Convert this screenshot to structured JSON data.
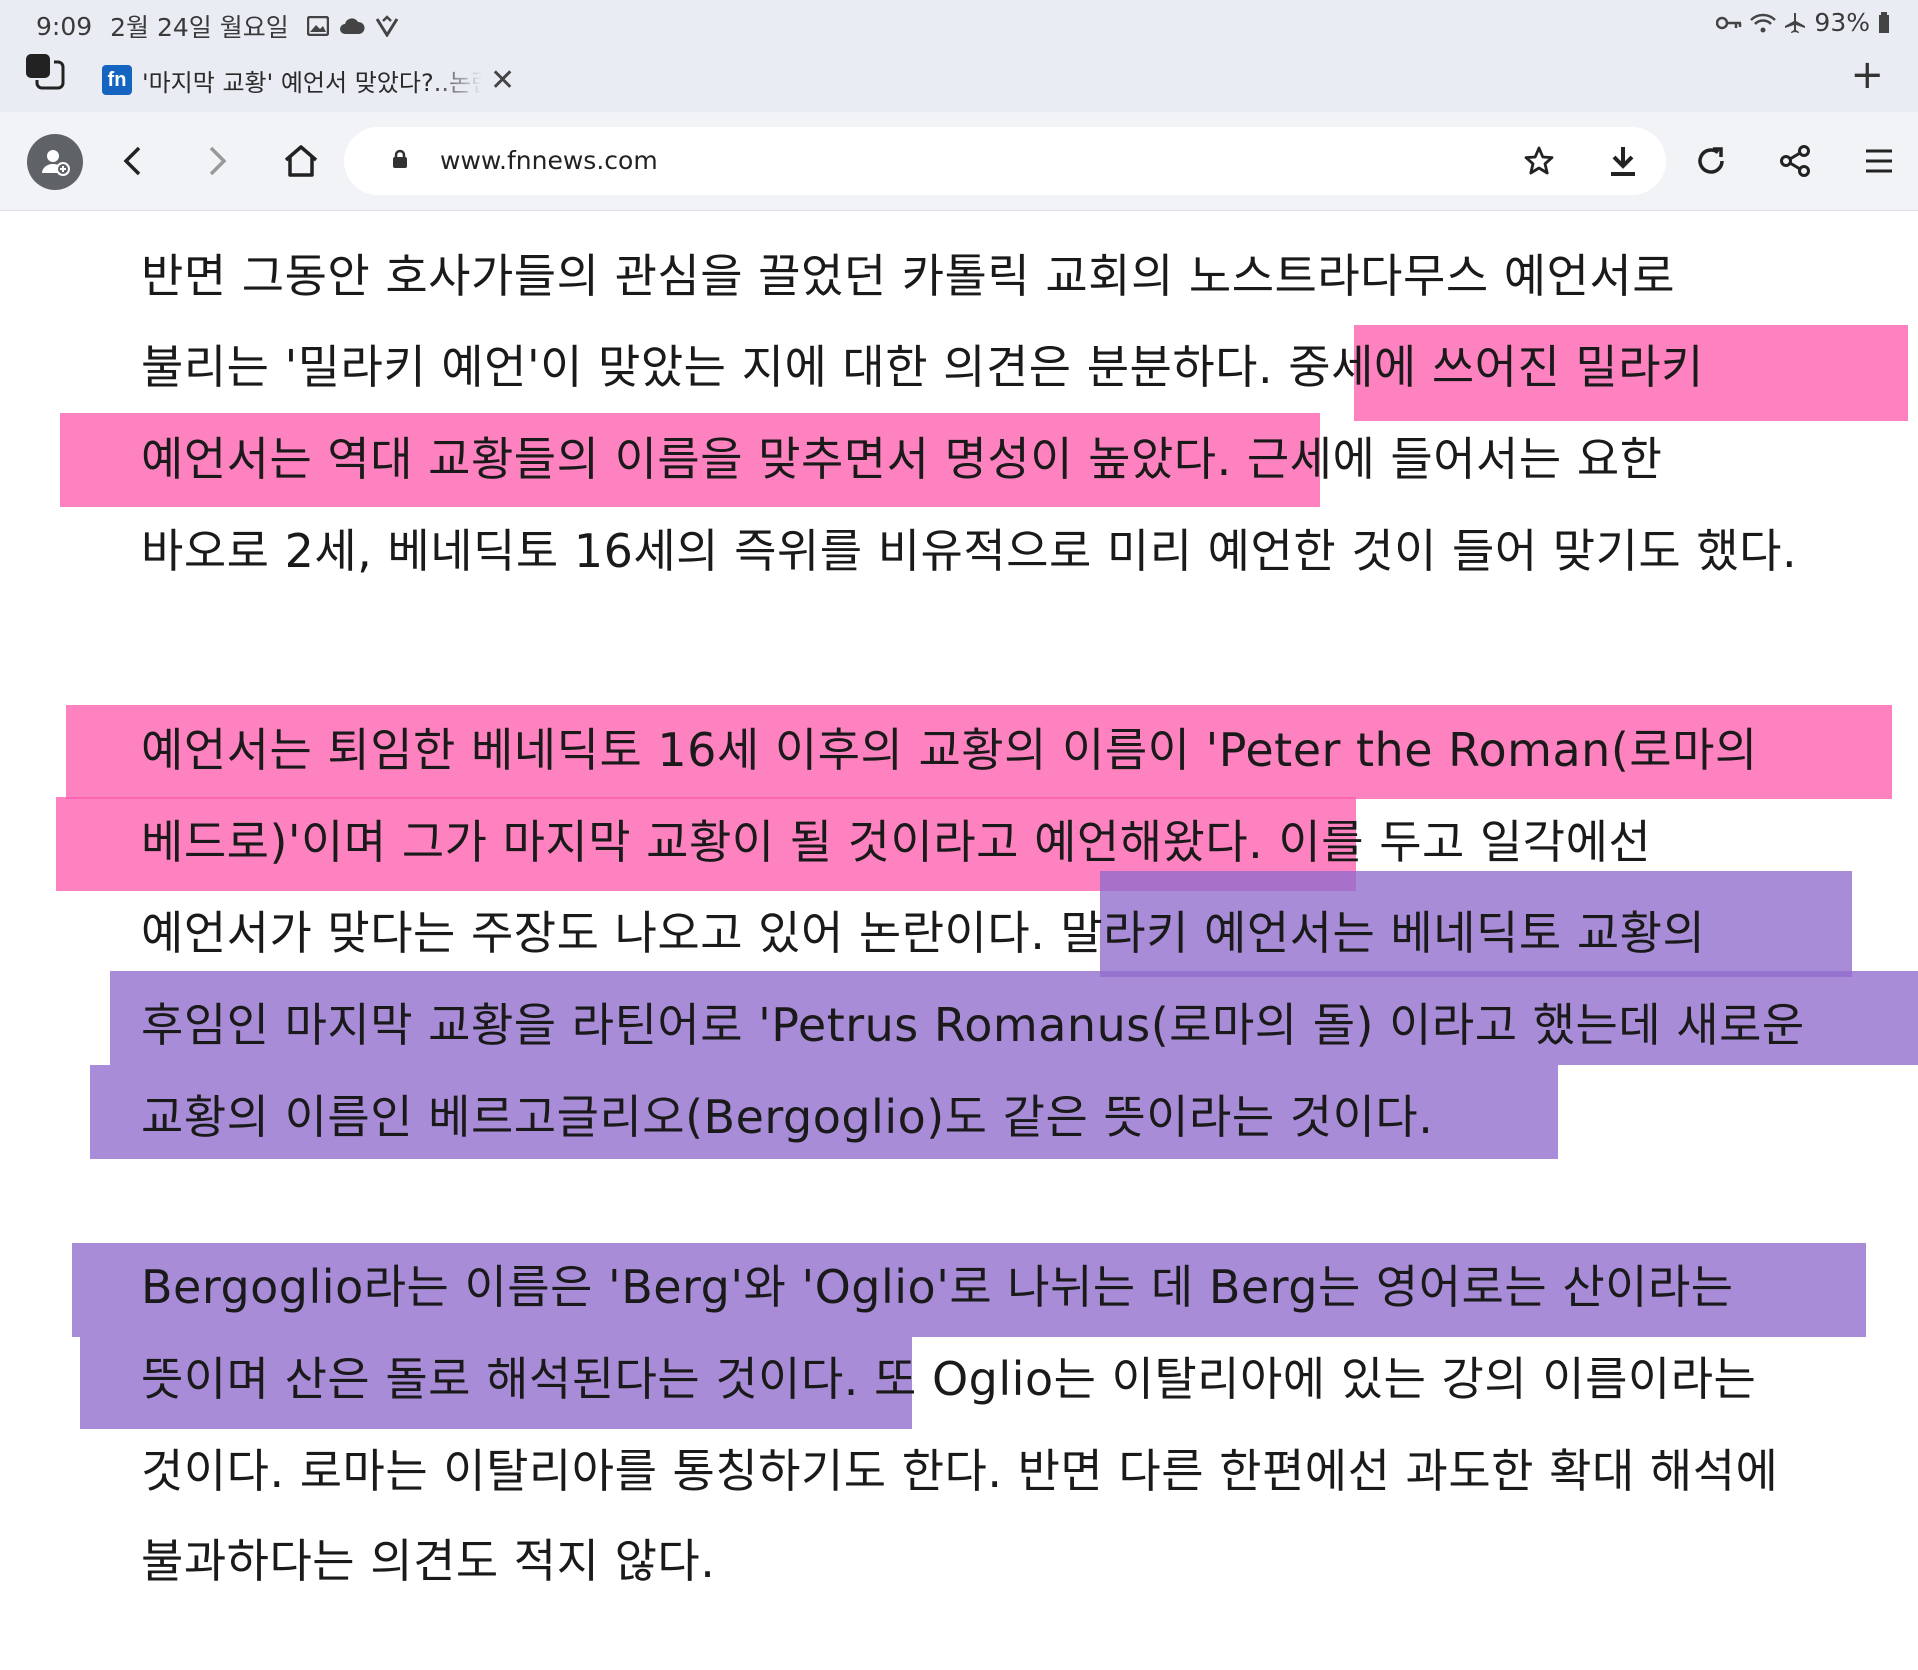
{
  "status_bar": {
    "time": "9:09",
    "date": "2월 24일 월요일",
    "battery": "93%"
  },
  "tab": {
    "favicon": "fn",
    "title": "'마지막 교황' 예언서 맞았다?..논란"
  },
  "toolbar": {
    "url": "www.fnnews.com"
  },
  "article": {
    "lines": [
      "반면 그동안 호사가들의 관심을 끌었던 카톨릭 교회의 노스트라다무스 예언서로",
      "불리는 '밀라키 예언'이 맞았는 지에 대한 의견은 분분하다. 중세에 쓰어진 밀라키",
      "예언서는 역대 교황들의 이름을 맞추면서 명성이 높았다. 근세에 들어서는 요한",
      "바오로 2세, 베네딕토 16세의 즉위를 비유적으로 미리 예언한 것이 들어 맞기도 했다.",
      "예언서는 퇴임한 베네딕토 16세 이후의 교황의 이름이 'Peter the Roman(로마의",
      "베드로)'이며 그가 마지막 교황이 될 것이라고 예언해왔다. 이를 두고 일각에선",
      "예언서가 맞다는 주장도 나오고 있어 논란이다. 말라키 예언서는 베네딕토 교황의",
      "후임인 마지막 교황을 라틴어로 'Petrus Romanus(로마의 돌) 이라고 했는데 새로운",
      "교황의 이름인 베르고글리오(Bergoglio)도 같은 뜻이라는 것이다.",
      "Bergoglio라는 이름은 'Berg'와 'Oglio'로 나뉘는 데 Berg는 영어로는 산이라는",
      "뜻이며 산은 돌로 해석된다는 것이다. 또 Oglio는 이탈리아에 있는 강의 이름이라는",
      "것이다. 로마는 이탈리아를 통칭하기도 한다. 반면 다른 한편에선 과도한 확대 해석에",
      "불과하다는 의견도 적지 않다."
    ]
  },
  "colors": {
    "highlight_pink": "#ff5fae",
    "highlight_purple": "#8f6ccc",
    "chrome_bg": "#e9edf3",
    "toolbar_bg": "#f1f3f7"
  },
  "icons": [
    "tab-switcher-icon",
    "gallery-icon",
    "cloud-icon",
    "vpn-icon",
    "key-icon",
    "wifi-icon",
    "airplane-icon",
    "battery-icon",
    "close-icon",
    "plus-icon",
    "profile-icon",
    "back-icon",
    "forward-icon",
    "home-icon",
    "lock-icon",
    "star-icon",
    "download-icon",
    "reload-icon",
    "share-icon",
    "menu-icon"
  ]
}
